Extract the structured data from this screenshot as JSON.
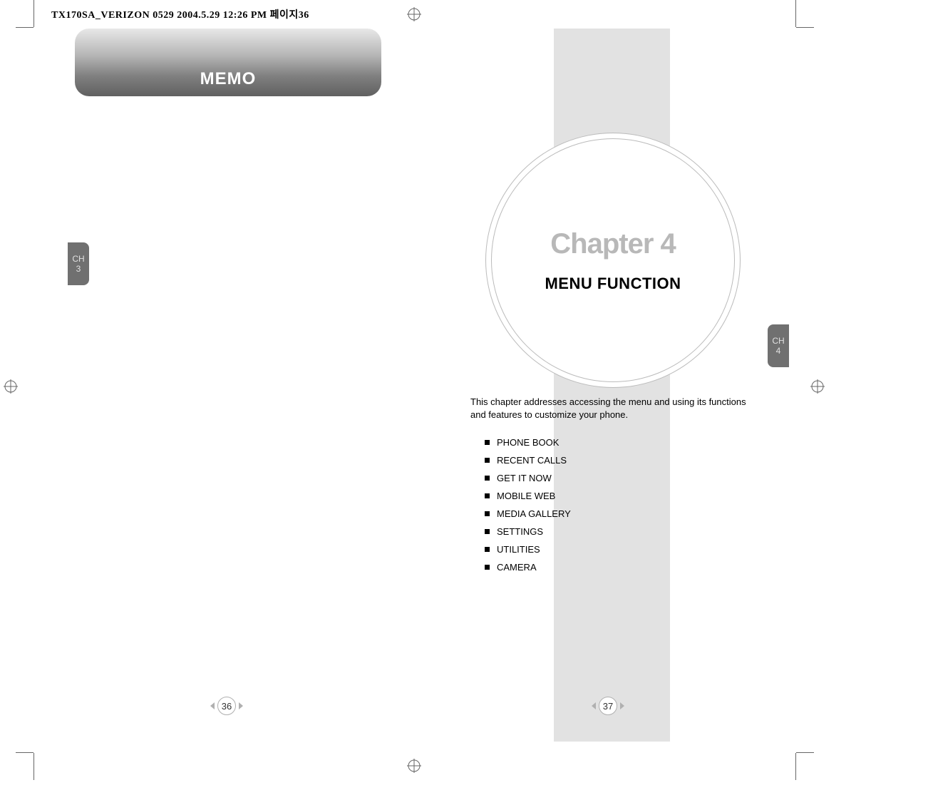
{
  "header": {
    "doc_info": "TX170SA_VERIZON 0529  2004.5.29 12:26 PM  페이지36"
  },
  "left_page": {
    "memo_label": "MEMO",
    "ch_tab": {
      "label": "CH",
      "number": "3"
    },
    "page_number": "36"
  },
  "right_page": {
    "chapter": {
      "title": "Chapter 4",
      "subtitle": "MENU FUNCTION"
    },
    "description": "This chapter addresses accessing the menu and using its functions and features to customize your phone.",
    "menu_items": [
      "PHONE BOOK",
      "RECENT CALLS",
      "GET IT NOW",
      "MOBILE WEB",
      "MEDIA GALLERY",
      "SETTINGS",
      "UTILITIES",
      "CAMERA"
    ],
    "ch_tab": {
      "label": "CH",
      "number": "4"
    },
    "page_number": "37"
  }
}
